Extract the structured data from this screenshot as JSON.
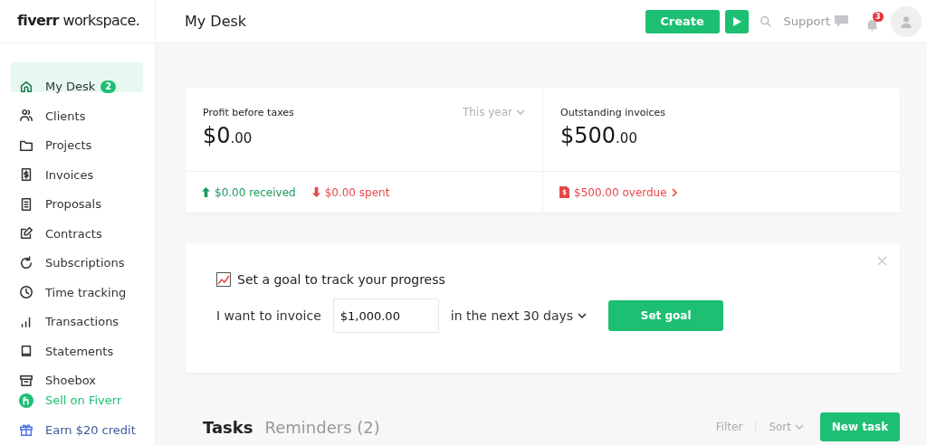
{
  "logo": "**fiverr** workspace.",
  "header": {
    "title": "My Desk",
    "create_button": "Create",
    "support": "Support",
    "notification_count": "3"
  },
  "sidebar": {
    "items": [
      {
        "label": "My Desk",
        "kind": "nav",
        "selected": true,
        "badge": "2"
      },
      {
        "label": "Clients",
        "kind": "nav",
        "selected": false
      },
      {
        "label": "Projects",
        "kind": "nav",
        "selected": false
      },
      {
        "label": "Invoices",
        "kind": "nav",
        "selected": false
      },
      {
        "label": "Proposals",
        "kind": "nav",
        "selected": false
      },
      {
        "label": "Contracts",
        "kind": "nav",
        "selected": false
      },
      {
        "label": "Subscriptions",
        "kind": "nav",
        "selected": false
      },
      {
        "label": "Time tracking",
        "kind": "nav",
        "selected": false
      },
      {
        "label": "Transactions",
        "kind": "nav",
        "selected": false
      },
      {
        "label": "Statements",
        "kind": "nav",
        "selected": false
      },
      {
        "label": "Shoebox",
        "kind": "nav",
        "selected": false
      },
      {
        "label": "Sell on Fiverr",
        "kind": "sell",
        "selected": false
      },
      {
        "label": "Earn $20 credit",
        "kind": "earn",
        "selected": false
      }
    ]
  },
  "summary": {
    "profit": {
      "label": "Profit before taxes",
      "period": "This year",
      "amount": "$0",
      "cents": ".00",
      "received": "$0.00 received",
      "spent": "$0.00 spent"
    },
    "outstanding": {
      "label": "Outstanding invoices",
      "amount": "$500",
      "cents": ".00",
      "overdue": "$500.00 overdue"
    }
  },
  "goal": {
    "title": "Set a goal to track your progress",
    "prefix": "I want to invoice",
    "amount": "$1,000.00",
    "period": "in the next 30 days",
    "button": "Set goal"
  },
  "tasks": {
    "tabs": [
      {
        "label": "Tasks",
        "selected": true
      },
      {
        "label": "Reminders (2)",
        "selected": false
      }
    ],
    "filter": "Filter",
    "sort": "Sort",
    "new_button": "New task"
  }
}
